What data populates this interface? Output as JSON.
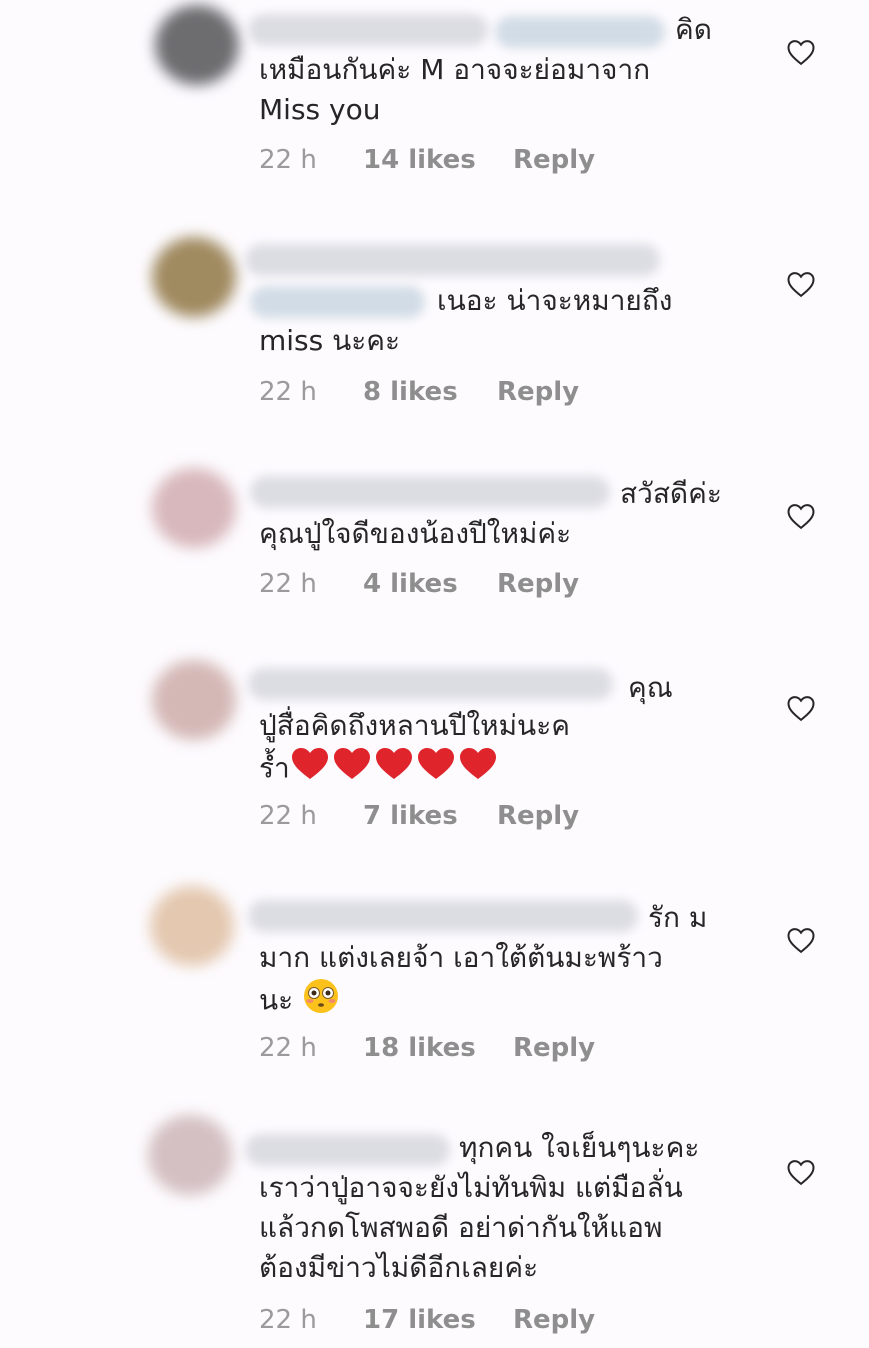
{
  "comments": [
    {
      "lines": [
        "คิด",
        "เหมือนกันค่ะ M อาจจะย่อมาจาก",
        "Miss you"
      ],
      "time": "22 h",
      "likes": "14 likes",
      "reply": "Reply"
    },
    {
      "lines": [
        "เนอะ น่าจะหมายถึง",
        "miss นะคะ"
      ],
      "time": "22 h",
      "likes": "8 likes",
      "reply": "Reply"
    },
    {
      "lines": [
        "สวัสดีค่ะ",
        "คุณปู่ใจดีของน้องปีใหม่ค่ะ"
      ],
      "time": "22 h",
      "likes": "4 likes",
      "reply": "Reply"
    },
    {
      "lines": [
        "คุณ",
        "ปู่สื่อคิดถึงหลานปีใหม่นะค",
        "ร้ำ"
      ],
      "emoji": "red-heart-emoji x5",
      "time": "22 h",
      "likes": "7 likes",
      "reply": "Reply"
    },
    {
      "lines": [
        "รัก ม",
        "มาก แต่งเลยจ้า เอาใต้ต้นมะพร้าว",
        "นะ"
      ],
      "emoji": "flushed-face-emoji",
      "time": "22 h",
      "likes": "18 likes",
      "reply": "Reply"
    },
    {
      "lines": [
        "ทุกคน ใจเย็นๆนะคะ",
        "เราว่าปู่อาจจะยังไม่ทันพิม แต่มือลั่น",
        "แล้วกดโพสพอดี อย่าด่ากันให้แอพ",
        "ต้องมีข่าวไม่ดีอีกเลยค่ะ"
      ],
      "time": "22 h",
      "likes": "17 likes",
      "reply": "Reply"
    }
  ],
  "icons": {
    "like": "heart-outline-icon"
  },
  "colors": {
    "text": "#262626",
    "meta": "#8e8e8e",
    "heart_emoji": "#e0242c"
  }
}
